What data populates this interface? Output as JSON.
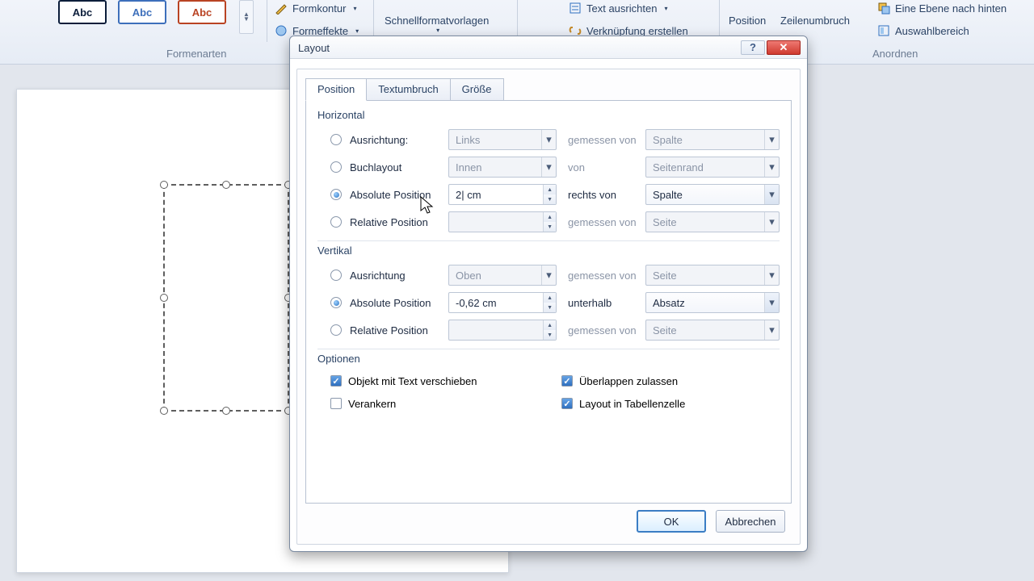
{
  "ribbon": {
    "formkontur": "Formkontur",
    "formeffekte": "Formeffekte",
    "schnellformat": "Schnellformatvorlagen",
    "textausrichten": "Text ausrichten",
    "verknuepfung": "Verknüpfung erstellen",
    "position": "Position",
    "zeilenumbruch": "Zeilenumbruch",
    "ebene_hinten": "Eine Ebene nach hinten",
    "auswahlbereich": "Auswahlbereich",
    "grp_formenarten": "Formenarten",
    "grp_anordnen": "Anordnen",
    "abc": "Abc"
  },
  "dialog": {
    "title": "Layout",
    "tabs": {
      "position": "Position",
      "textumbruch": "Textumbruch",
      "groesse": "Größe"
    },
    "horizontal": {
      "legend": "Horizontal",
      "ausrichtung_label": "Ausrichtung:",
      "ausrichtung_value": "Links",
      "ausrichtung_mid": "gemessen von",
      "ausrichtung_ref": "Spalte",
      "buchlayout_label": "Buchlayout",
      "buchlayout_value": "Innen",
      "buchlayout_mid": "von",
      "buchlayout_ref": "Seitenrand",
      "abs_label": "Absolute Position",
      "abs_value": "2| cm",
      "abs_mid": "rechts von",
      "abs_ref": "Spalte",
      "rel_label": "Relative Position",
      "rel_value": "",
      "rel_mid": "gemessen von",
      "rel_ref": "Seite"
    },
    "vertikal": {
      "legend": "Vertikal",
      "ausrichtung_label": "Ausrichtung",
      "ausrichtung_value": "Oben",
      "ausrichtung_mid": "gemessen von",
      "ausrichtung_ref": "Seite",
      "abs_label": "Absolute Position",
      "abs_value": "-0,62 cm",
      "abs_mid": "unterhalb",
      "abs_ref": "Absatz",
      "rel_label": "Relative Position",
      "rel_value": "",
      "rel_mid": "gemessen von",
      "rel_ref": "Seite"
    },
    "optionen": {
      "legend": "Optionen",
      "opt1": "Objekt mit Text verschieben",
      "opt2": "Verankern",
      "opt3": "Überlappen zulassen",
      "opt4": "Layout in Tabellenzelle",
      "checked": {
        "opt1": true,
        "opt2": false,
        "opt3": true,
        "opt4": true
      }
    },
    "ok": "OK",
    "cancel": "Abbrechen"
  }
}
